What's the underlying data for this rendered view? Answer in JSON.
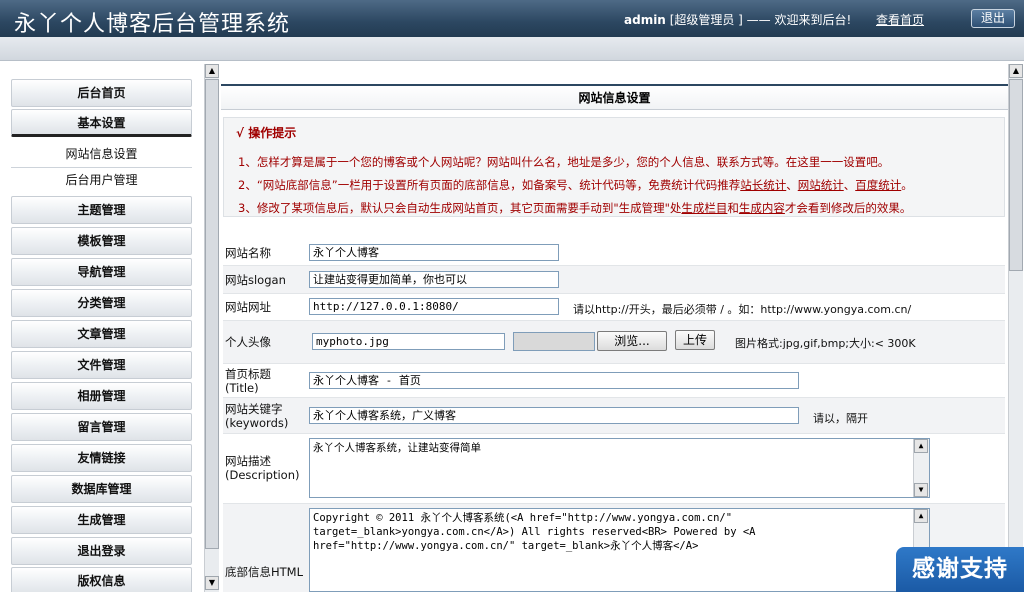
{
  "header": {
    "app_title": "永丫个人博客后台管理系统",
    "username": "admin",
    "role_text": "[超级管理员 ] —— 欢迎来到后台!",
    "view_home": "查看首页",
    "logout": "退出"
  },
  "sidebar": {
    "items": [
      {
        "label": "后台首页"
      },
      {
        "label": "基本设置"
      },
      {
        "label": "网站信息设置"
      },
      {
        "label": "后台用户管理"
      },
      {
        "label": "主题管理"
      },
      {
        "label": "模板管理"
      },
      {
        "label": "导航管理"
      },
      {
        "label": "分类管理"
      },
      {
        "label": "文章管理"
      },
      {
        "label": "文件管理"
      },
      {
        "label": "相册管理"
      },
      {
        "label": "留言管理"
      },
      {
        "label": "友情链接"
      },
      {
        "label": "数据库管理"
      },
      {
        "label": "生成管理"
      },
      {
        "label": "退出登录"
      },
      {
        "label": "版权信息"
      }
    ]
  },
  "main": {
    "heading": "网站信息设置",
    "tips": {
      "icon": "√",
      "title": "操作提示",
      "line1": "1、怎样才算是属于一个您的博客或个人网站呢？网站叫什么名，地址是多少，您的个人信息、联系方式等。在这里一一设置吧。",
      "line2_a": "2、“网站底部信息”一栏用于设置所有页面的底部信息，如备案号、统计代码等，免费统计代码推荐",
      "link_51la": "站长统计",
      "sep1": "、",
      "link_cnzz": "网站统计",
      "sep2": "、",
      "link_baidu": "百度统计",
      "line2_end": "。",
      "line3_a": "3、修改了某项信息后，默认只会自动生成网站首页，其它页面需要手动到\"生成管理\"处",
      "link_gen_col": "生成栏目",
      "line3_b": "和",
      "link_gen_content": "生成内容",
      "line3_c": "才会看到修改后的效果。"
    },
    "form": {
      "site_name_label": "网站名称",
      "site_name_value": "永丫个人博客",
      "slogan_label": "网站slogan",
      "slogan_value": "让建站变得更加简单，你也可以",
      "url_label": "网站网址",
      "url_value": "http://127.0.0.1:8080/",
      "url_hint": "请以http://开头，最后必须带 / 。如：http://www.yongya.com.cn/",
      "avatar_label": "个人头像",
      "avatar_value": "myphoto.jpg",
      "browse_button": "浏览...",
      "upload_button": "上传",
      "avatar_hint": "图片格式:jpg,gif,bmp;大小:< 300K",
      "home_title_label": "首页标题",
      "home_title_label_en": "(Title)",
      "home_title_value": "永丫个人博客 - 首页",
      "keywords_label": "网站关键字",
      "keywords_label_en": "(keywords)",
      "keywords_value": "永丫个人博客系统，广义博客",
      "keywords_hint": "请以，隔开",
      "desc_label": "网站描述",
      "desc_label_en": "(Description)",
      "desc_value": "永丫个人博客系统，让建站变得简单",
      "footer_label": "底部信息HTML",
      "footer_value": "Copyright © 2011 永丫个人博客系统(<A href=\"http://www.yongya.com.cn/\" target=_blank>yongya.com.cn</A>) All rights reserved<BR> Powered by <A href=\"http://www.yongya.com.cn/\" target=_blank>永丫个人博客</A>"
    }
  },
  "badge": {
    "text": "感谢支持"
  },
  "colors": {
    "header_bg": "#2c4761",
    "tip_text": "#a00000",
    "badge_bg": "#1b5aa5"
  }
}
